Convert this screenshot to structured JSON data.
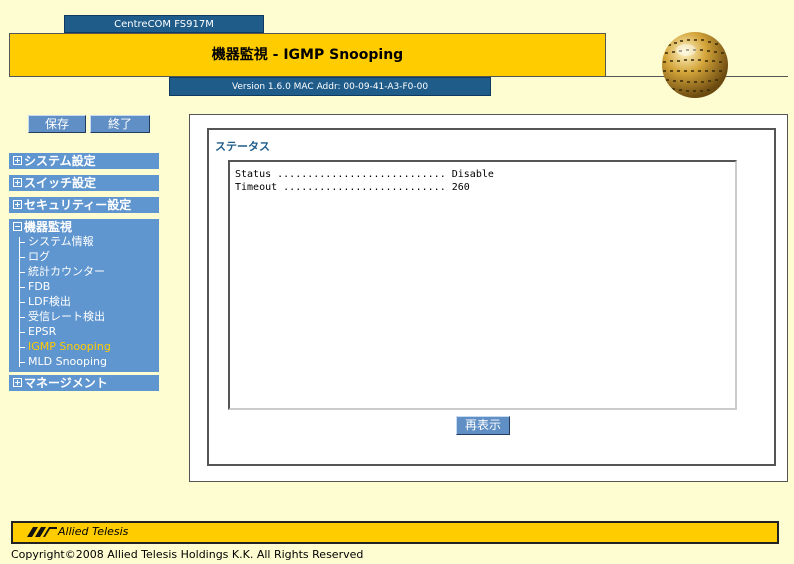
{
  "header": {
    "model": "CentreCOM FS917M",
    "title": "機器監視 - IGMP Snooping",
    "version": "Version 1.6.0 MAC Addr: 00-09-41-A3-F0-00"
  },
  "actions": {
    "save_label": "保存",
    "exit_label": "終了"
  },
  "sidebar": {
    "sections": [
      {
        "label": "システム設定",
        "expanded": false
      },
      {
        "label": "スイッチ設定",
        "expanded": false
      },
      {
        "label": "セキュリティー設定",
        "expanded": false
      },
      {
        "label": "機器監視",
        "expanded": true
      },
      {
        "label": "マネージメント",
        "expanded": false
      }
    ],
    "monitor_items": [
      "システム情報",
      "ログ",
      "統計カウンター",
      "FDB",
      "LDF検出",
      "受信レート検出",
      "EPSR",
      "IGMP Snooping",
      "MLD Snooping"
    ],
    "active_item": "IGMP Snooping"
  },
  "main": {
    "heading": "ステータス",
    "lines": [
      "Status ............................ Disable",
      "Timeout ........................... 260"
    ],
    "refresh_label": "再表示"
  },
  "footer": {
    "brand": "Allied Telesis",
    "copyright": "Copyright©2008 Allied Telesis Holdings K.K. All Rights Reserved"
  },
  "colors": {
    "background": "#fefdd2",
    "accent_yellow": "#ffcc00",
    "nav_blue": "#6096cf",
    "header_blue": "#1f5c8a",
    "active_item": "#ffcc00"
  }
}
